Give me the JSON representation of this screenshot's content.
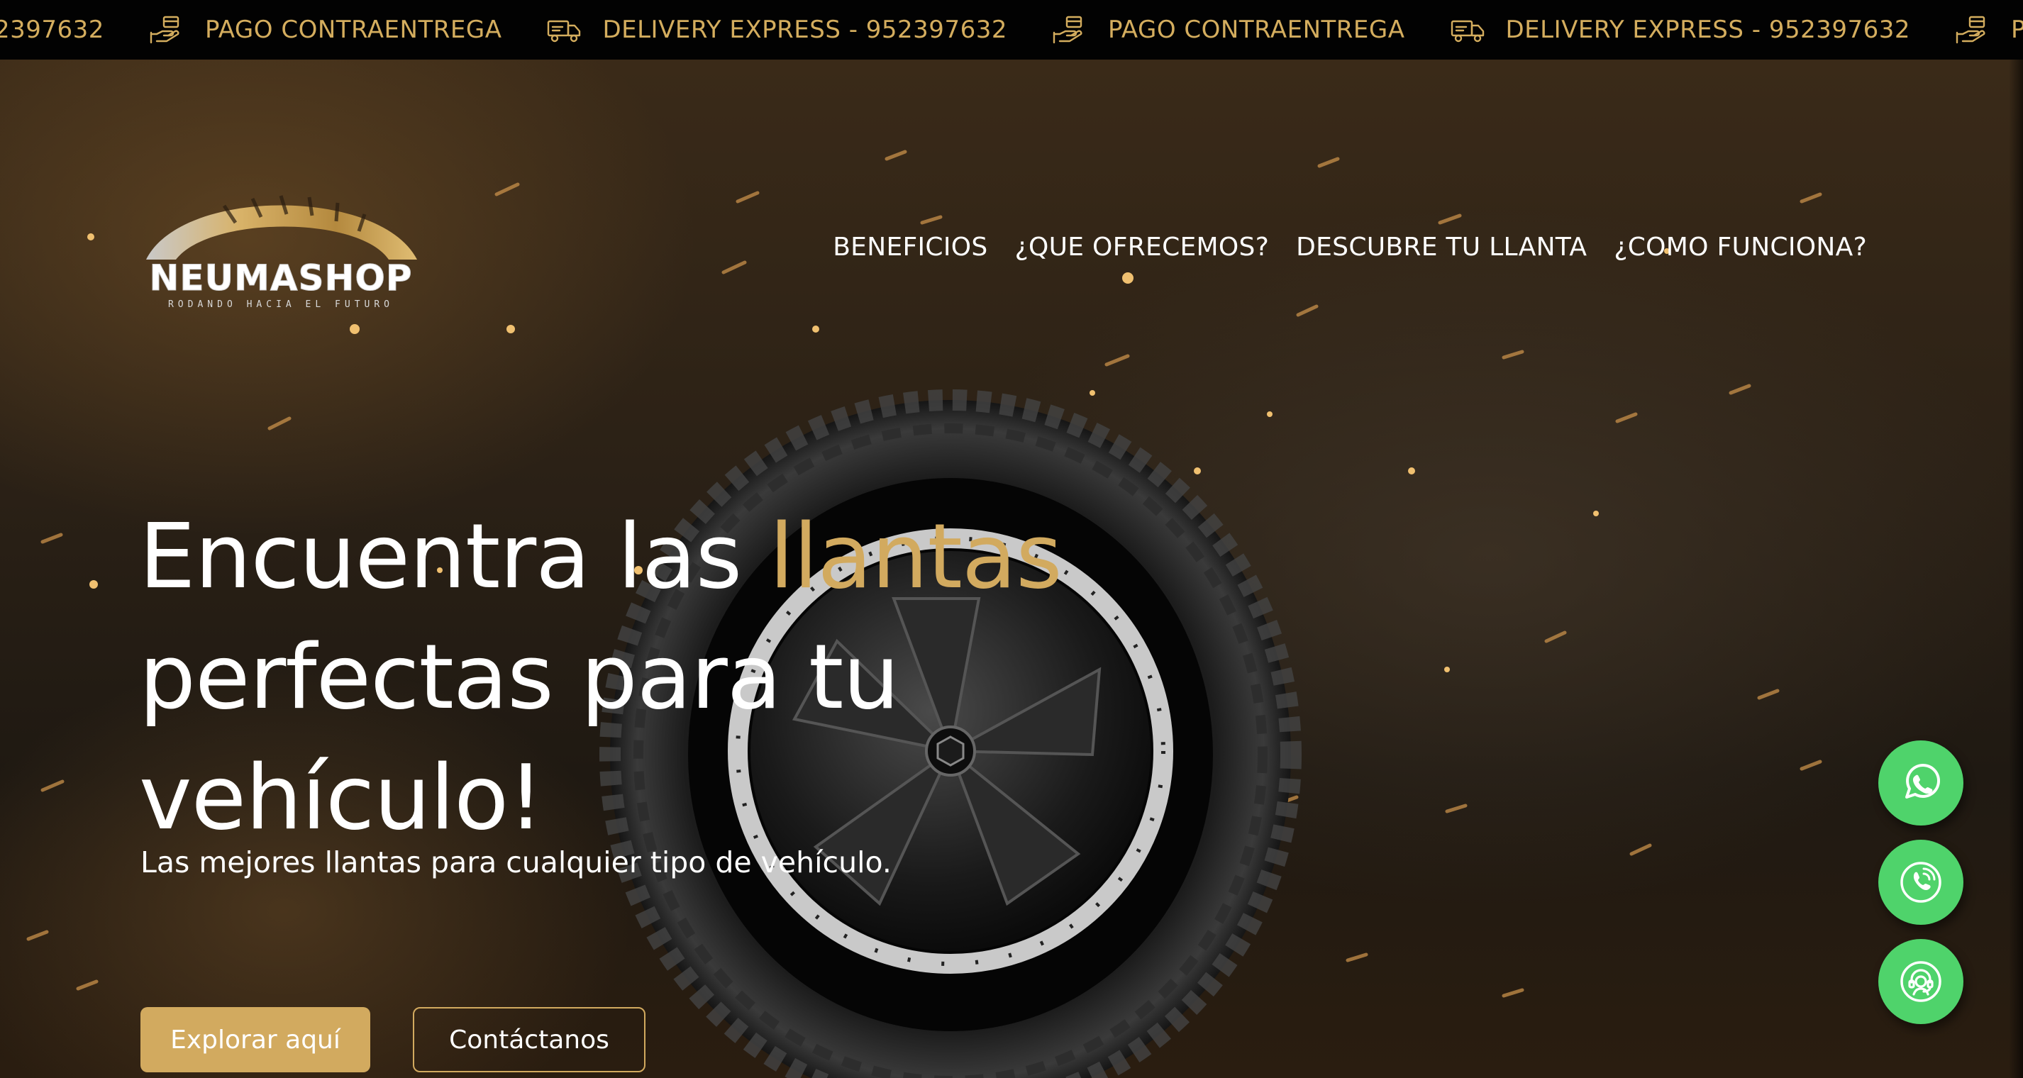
{
  "ticker": {
    "items": [
      {
        "icon": "hand-coins-icon",
        "text": "PAGO CONTRAENTREGA"
      },
      {
        "icon": "delivery-truck-icon",
        "text": "DELIVERY EXPRESS - 952397632"
      },
      {
        "icon": "hand-coins-icon",
        "text": "PAGO CONTRAENTREGA"
      },
      {
        "icon": "delivery-truck-icon",
        "text": "DELIVERY EXPRESS - 952397632"
      },
      {
        "icon": "hand-coins-icon",
        "text": "PAGO CONTRAENTREGA"
      }
    ],
    "leading_fragment": "2397632",
    "color": "#d4ad5e"
  },
  "logo": {
    "brand": "NEUMASHOP",
    "tagline": "RODANDO HACIA EL FUTURO"
  },
  "nav": {
    "items": [
      "BENEFICIOS",
      "¿QUE OFRECEMOS?",
      "DESCUBRE TU LLANTA",
      "¿COMO FUNCIONA?"
    ]
  },
  "hero": {
    "headline_part1": "Encuentra las ",
    "headline_accent": "llantas",
    "headline_part2": " perfectas para tu vehículo!",
    "subheadline": "Las mejores llantas para cualquier tipo de vehículo.",
    "primary_button": "Explorar aquí",
    "secondary_button": "Contáctanos",
    "accent_color": "#d2aa5f"
  },
  "floating_buttons": [
    {
      "icon": "whatsapp-icon"
    },
    {
      "icon": "phone-call-icon"
    },
    {
      "icon": "support-agent-icon"
    }
  ],
  "colors": {
    "gold": "#d2aa5f",
    "fab_green": "#4fd36b",
    "ticker_bg": "#020202"
  }
}
